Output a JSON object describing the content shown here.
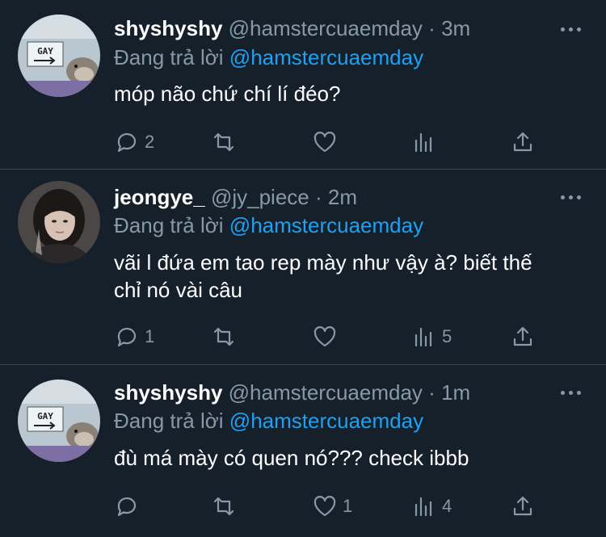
{
  "tweets": [
    {
      "name": "shyshyshy",
      "handle": "@hamstercuaemday",
      "sep": "·",
      "time": "3m",
      "reply_prefix": "Đang trả lời",
      "reply_mention": "@hamstercuaemday",
      "lines": [
        "móp não chứ chí lí đéo?"
      ],
      "avatar_text": "GAY",
      "counts": {
        "reply": "2",
        "retweet": "",
        "like": "",
        "views": "",
        "share": ""
      }
    },
    {
      "name": "jeongye_",
      "handle": "@jy_piece",
      "sep": "·",
      "time": "2m",
      "reply_prefix": "Đang trả lời",
      "reply_mention": "@hamstercuaemday",
      "lines": [
        "vãi l đứa em tao rep mày như vậy à? biết thế",
        "chỉ nó vài câu"
      ],
      "avatar_text": "",
      "counts": {
        "reply": "1",
        "retweet": "",
        "like": "",
        "views": "5",
        "share": ""
      }
    },
    {
      "name": "shyshyshy",
      "handle": "@hamstercuaemday",
      "sep": "·",
      "time": "1m",
      "reply_prefix": "Đang trả lời",
      "reply_mention": "@hamstercuaemday",
      "lines": [
        "đù má mày có quen nó??? check ibbb"
      ],
      "avatar_text": "GAY",
      "counts": {
        "reply": "",
        "retweet": "",
        "like": "1",
        "views": "4",
        "share": ""
      }
    }
  ],
  "colors": {
    "background": "#15202b",
    "divider": "#38444d",
    "secondary_text": "#8899a6",
    "link": "#1da1f2"
  },
  "icons": [
    "reply-icon",
    "retweet-icon",
    "like-icon",
    "views-icon",
    "share-icon",
    "more-icon"
  ]
}
